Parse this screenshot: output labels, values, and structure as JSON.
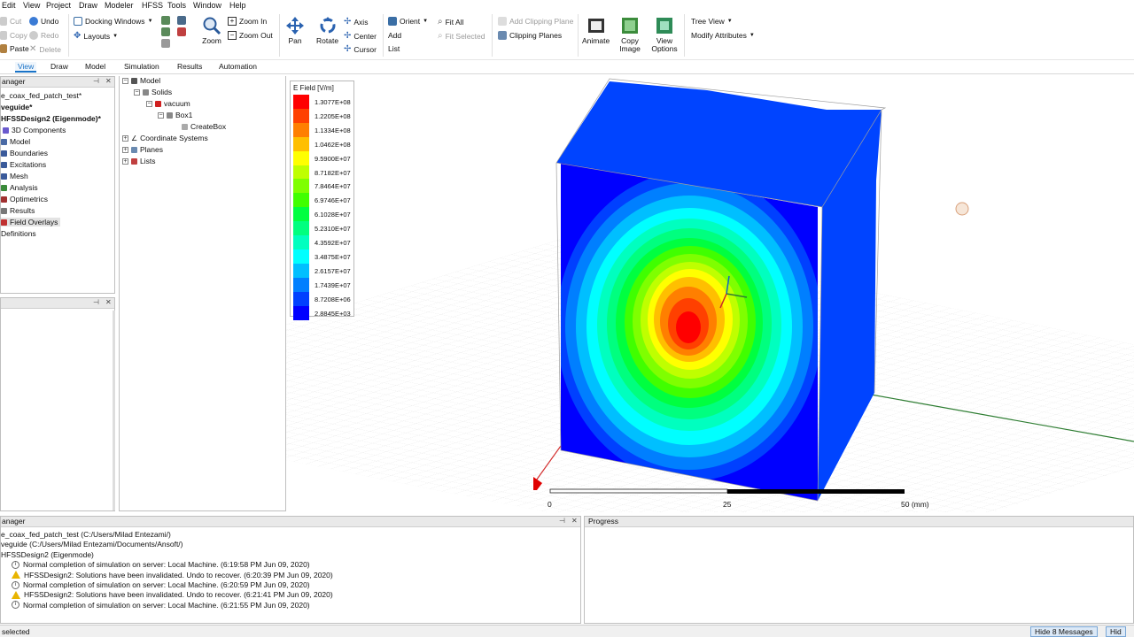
{
  "menu": [
    "Edit",
    "View",
    "Project",
    "Draw",
    "Modeler",
    "HFSS",
    "Tools",
    "Window",
    "Help"
  ],
  "ribbon": {
    "cut": "Cut",
    "copy": "Copy",
    "paste": "Paste",
    "undo": "Undo",
    "redo": "Redo",
    "delete": "Delete",
    "docking_windows": "Docking Windows",
    "layouts": "Layouts",
    "zoom": "Zoom",
    "zoom_in": "Zoom In",
    "zoom_out": "Zoom Out",
    "pan": "Pan",
    "rotate": "Rotate",
    "axis": "Axis",
    "center": "Center",
    "cursor": "Cursor",
    "orient": "Orient",
    "add": "Add",
    "list": "List",
    "fit_all": "Fit All",
    "fit_selected": "Fit Selected",
    "add_clipping_plane": "Add Clipping Plane",
    "clipping_planes": "Clipping Planes",
    "animate": "Animate",
    "copy_image": "Copy Image",
    "view_options": "View Options",
    "tree_view": "Tree View",
    "modify_attributes": "Modify Attributes"
  },
  "tabs": [
    "View",
    "Draw",
    "Model",
    "Simulation",
    "Results",
    "Automation"
  ],
  "active_tab": "View",
  "project_manager": {
    "title": "anager",
    "items": [
      "e_coax_fed_patch_test*",
      "veguide*",
      "HFSSDesign2 (Eigenmode)*",
      "3D Components",
      "Model",
      "Boundaries",
      "Excitations",
      "Mesh",
      "Analysis",
      "Optimetrics",
      "Results",
      "Field Overlays",
      "Definitions"
    ]
  },
  "model_tree": [
    "Model",
    "Solids",
    "vacuum",
    "Box1",
    "CreateBox",
    "Coordinate Systems",
    "Planes",
    "Lists"
  ],
  "legend": {
    "title": "E Field [V/m]",
    "values": [
      "1.3077E+08",
      "1.2205E+08",
      "1.1334E+08",
      "1.0462E+08",
      "9.5900E+07",
      "8.7182E+07",
      "7.8464E+07",
      "6.9746E+07",
      "6.1028E+07",
      "5.2310E+07",
      "4.3592E+07",
      "3.4875E+07",
      "2.6157E+07",
      "1.7439E+07",
      "8.7208E+06",
      "2.8845E+03"
    ],
    "colors": [
      "#ff0000",
      "#ff4000",
      "#ff7f00",
      "#ffbf00",
      "#ffff00",
      "#bfff00",
      "#7fff00",
      "#40ff00",
      "#00ff40",
      "#00ff7f",
      "#00ffbf",
      "#00ffff",
      "#00bfff",
      "#007fff",
      "#0040ff",
      "#0000ff"
    ]
  },
  "scale": {
    "left": "0",
    "mid": "25",
    "right": "50 (mm)"
  },
  "message_manager": {
    "title": "anager",
    "lines": [
      {
        "type": "none",
        "text": "e_coax_fed_patch_test (C:/Users/Milad Entezami/)"
      },
      {
        "type": "none",
        "text": "veguide (C:/Users/Milad Entezami/Documents/Ansoft/)"
      },
      {
        "type": "none",
        "text": "HFSSDesign2 (Eigenmode)"
      },
      {
        "type": "info",
        "text": "Normal completion of simulation on server: Local Machine. (6:19:58 PM  Jun 09, 2020)"
      },
      {
        "type": "warn",
        "text": "HFSSDesign2: Solutions have been invalidated. Undo to recover. (6:20:39 PM  Jun 09, 2020)"
      },
      {
        "type": "info",
        "text": "Normal completion of simulation on server: Local Machine. (6:20:59 PM  Jun 09, 2020)"
      },
      {
        "type": "warn",
        "text": "HFSSDesign2: Solutions have been invalidated. Undo to recover. (6:21:41 PM  Jun 09, 2020)"
      },
      {
        "type": "info",
        "text": "Normal completion of simulation on server: Local Machine. (6:21:55 PM  Jun 09, 2020)"
      }
    ]
  },
  "progress": {
    "title": "Progress"
  },
  "status": {
    "left": "selected",
    "hide_messages": "Hide 8 Messages",
    "hide": "Hid"
  }
}
